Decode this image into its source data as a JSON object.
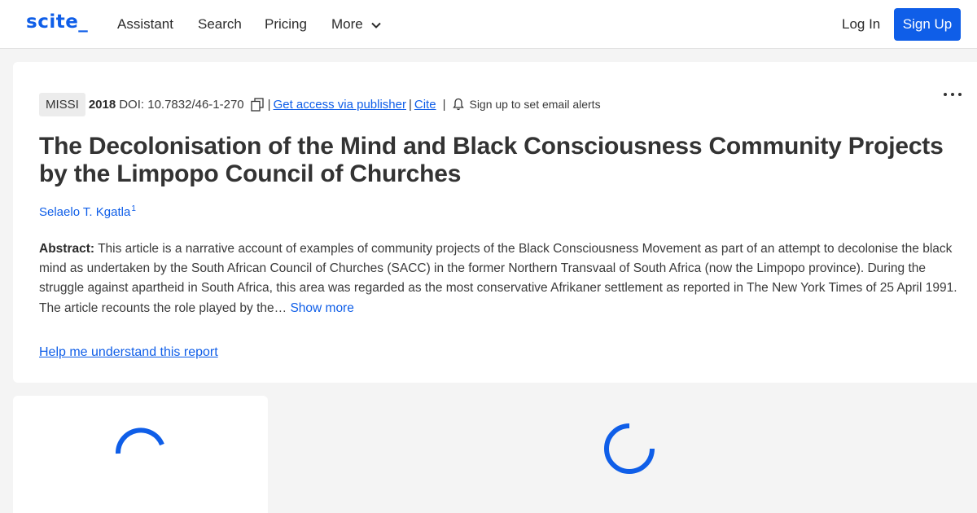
{
  "header": {
    "logo": "scite_",
    "nav": {
      "assistant": "Assistant",
      "search": "Search",
      "pricing": "Pricing",
      "more": "More"
    },
    "login": "Log In",
    "signup": "Sign Up"
  },
  "article": {
    "journal": "MISSI",
    "year": "2018",
    "doi": "DOI: 10.7832/46-1-270",
    "separator": "|",
    "access_link": "Get access via publisher",
    "cite_link": "Cite",
    "alerts_text": "Sign up to set email alerts",
    "title": "The Decolonisation of the Mind and Black Consciousness Community Projects by the Limpopo Council of Churches",
    "author": "Selaelo T. Kgatla",
    "author_sup": "1",
    "abstract_label": "Abstract:",
    "abstract_text": " This article is a narrative account of examples of community projects of the Black Consciousness Movement as part of an attempt to decolonise the black mind as undertaken by the South African Council of Churches (SACC) in the former Northern Transvaal of South Africa (now the Limpopo province). During the struggle against apartheid in South Africa, this area was regarded as the most conservative Afrikaner settlement as reported in The New York Times of 25 April 1991. The article recounts the role played by the…",
    "show_more": " Show more",
    "help_link": "Help me understand this report"
  },
  "colors": {
    "accent": "#0f5ee8",
    "background": "#f4f4f4",
    "card": "#ffffff"
  },
  "icons": [
    "chevron-down-icon",
    "copy-icon",
    "bell-icon",
    "more-options-icon",
    "loading-spinner-icon"
  ]
}
